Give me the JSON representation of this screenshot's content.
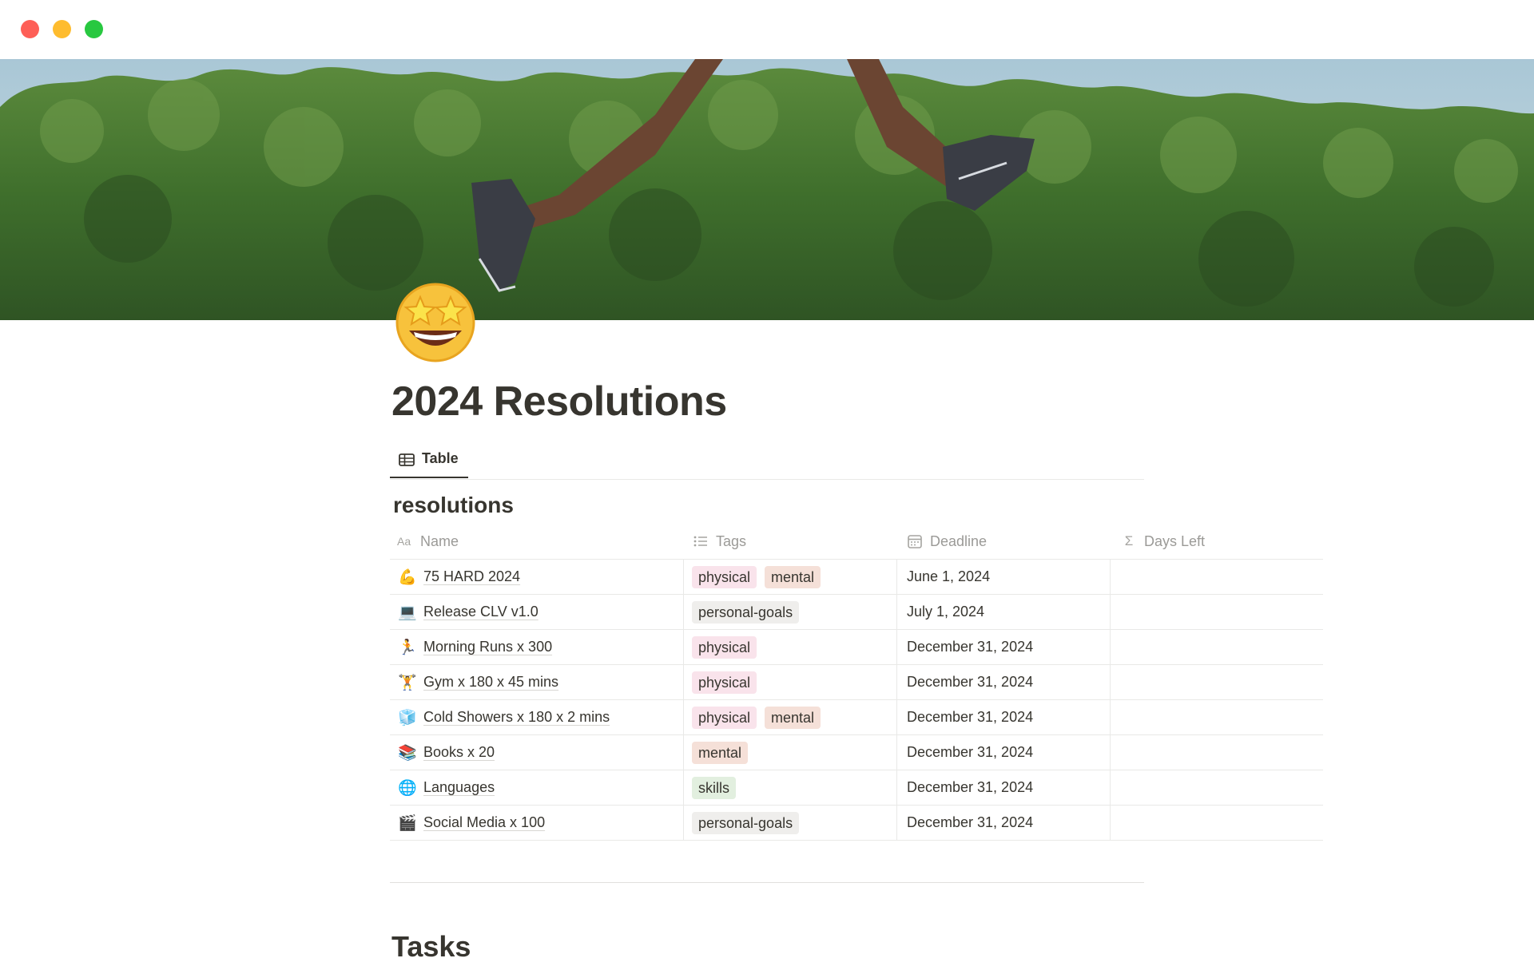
{
  "page": {
    "title": "2024 Resolutions",
    "icon": "star-struck-emoji",
    "cover": "photo: legs of a runner jumping over a forest canopy under blue sky",
    "next_section_heading": "Tasks"
  },
  "view_tabs": [
    {
      "label": "Table",
      "icon": "table-icon"
    }
  ],
  "database": {
    "title": "resolutions",
    "columns": [
      {
        "label": "Name",
        "icon": "text-property-icon"
      },
      {
        "label": "Tags",
        "icon": "multi-select-icon"
      },
      {
        "label": "Deadline",
        "icon": "calendar-icon"
      },
      {
        "label": "Days Left",
        "icon": "sigma-formula-icon"
      }
    ],
    "rows": [
      {
        "emoji": "💪",
        "emoji_name": "flexed-biceps-icon",
        "name": "75 HARD 2024",
        "tags": [
          "physical",
          "mental"
        ],
        "deadline": "June 1, 2024",
        "days_left": ""
      },
      {
        "emoji": "💻",
        "emoji_name": "laptop-icon",
        "name": "Release CLV v1.0",
        "tags": [
          "personal-goals"
        ],
        "deadline": "July 1, 2024",
        "days_left": ""
      },
      {
        "emoji": "🏃",
        "emoji_name": "runner-icon",
        "name": "Morning Runs x 300",
        "tags": [
          "physical"
        ],
        "deadline": "December 31, 2024",
        "days_left": ""
      },
      {
        "emoji": "🏋",
        "emoji_name": "weightlifter-icon",
        "name": "Gym x 180 x 45 mins",
        "tags": [
          "physical"
        ],
        "deadline": "December 31, 2024",
        "days_left": ""
      },
      {
        "emoji": "🧊",
        "emoji_name": "ice-cube-icon",
        "name": "Cold Showers x 180 x 2 mins",
        "tags": [
          "physical",
          "mental"
        ],
        "deadline": "December 31, 2024",
        "days_left": ""
      },
      {
        "emoji": "📚",
        "emoji_name": "books-icon",
        "name": "Books x 20",
        "tags": [
          "mental"
        ],
        "deadline": "December 31, 2024",
        "days_left": ""
      },
      {
        "emoji": "🌐",
        "emoji_name": "globe-icon",
        "name": "Languages",
        "tags": [
          "skills"
        ],
        "deadline": "December 31, 2024",
        "days_left": ""
      },
      {
        "emoji": "🎬",
        "emoji_name": "clapper-board-icon",
        "name": "Social Media x 100",
        "tags": [
          "personal-goals"
        ],
        "deadline": "December 31, 2024",
        "days_left": ""
      }
    ]
  },
  "tag_colors": {
    "physical": "#f9e3eb",
    "mental": "#f5e0d8",
    "personal-goals": "#efeeec",
    "skills": "#e2efdf"
  },
  "window_controls": {
    "close": "#fe5f57",
    "minimize": "#febc2e",
    "zoom": "#28c840"
  }
}
